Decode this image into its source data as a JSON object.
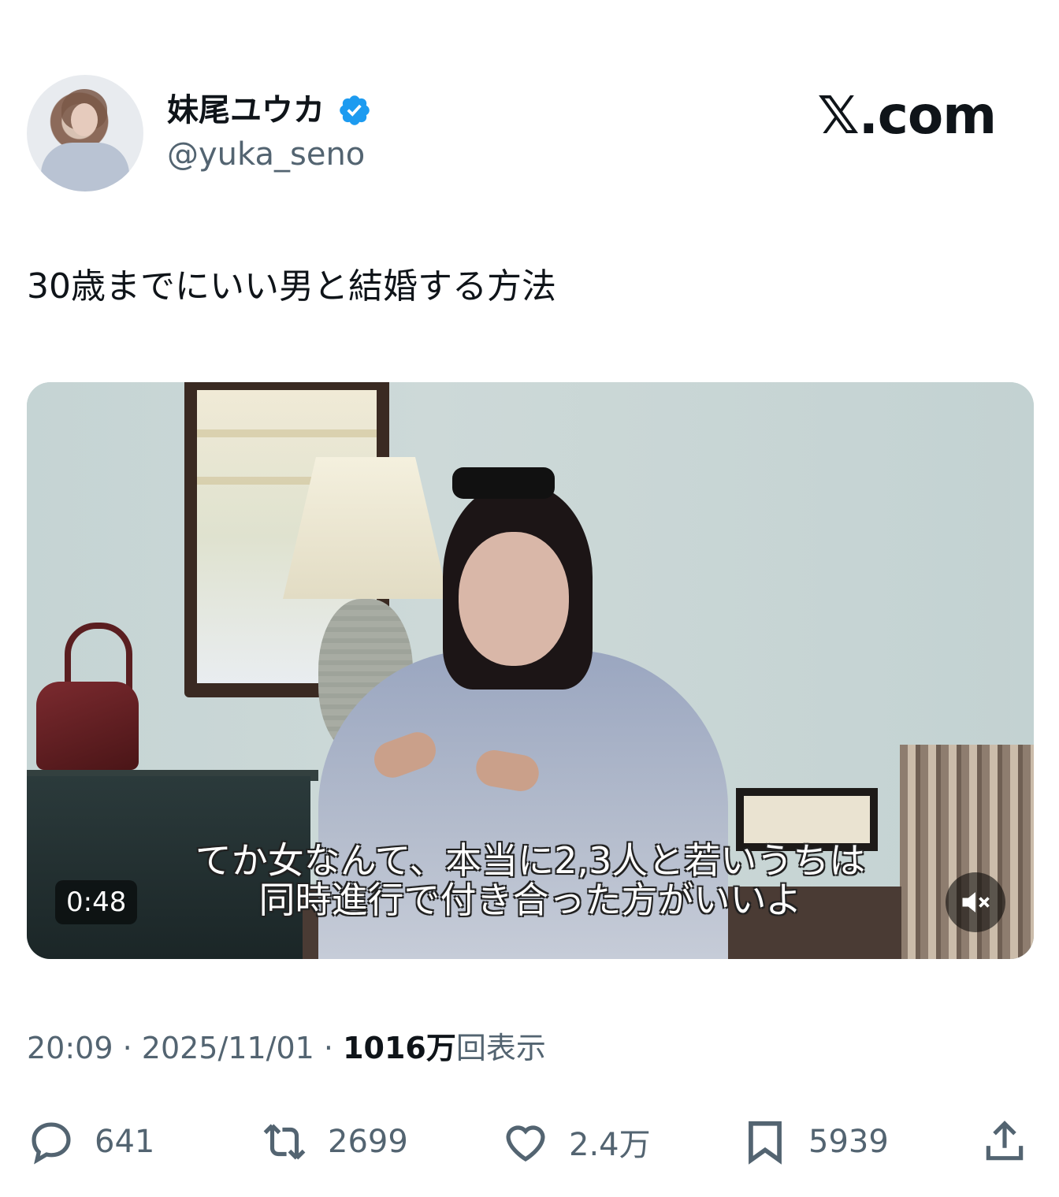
{
  "user": {
    "display_name": "妹尾ユウカ",
    "handle": "@yuka_seno",
    "verified": true
  },
  "brand": "𝕏.com",
  "tweet": {
    "text": "30歳までにいい男と結婚する方法"
  },
  "media": {
    "duration": "0:48",
    "subtitle_line1": "てか女なんて、本当に2,3人と若いうちは",
    "subtitle_line2": "同時進行で付き合った方がいいよ",
    "muted": true
  },
  "meta": {
    "time": "20:09",
    "date": "2025/11/01",
    "views_value": "1016万",
    "views_label": "回表示"
  },
  "actions": {
    "replies": "641",
    "reposts": "2699",
    "likes": "2.4万",
    "bookmarks": "5939"
  },
  "colors": {
    "verified_blue": "#1d9bf0",
    "secondary_text": "#536471",
    "primary_text": "#0f1419"
  }
}
